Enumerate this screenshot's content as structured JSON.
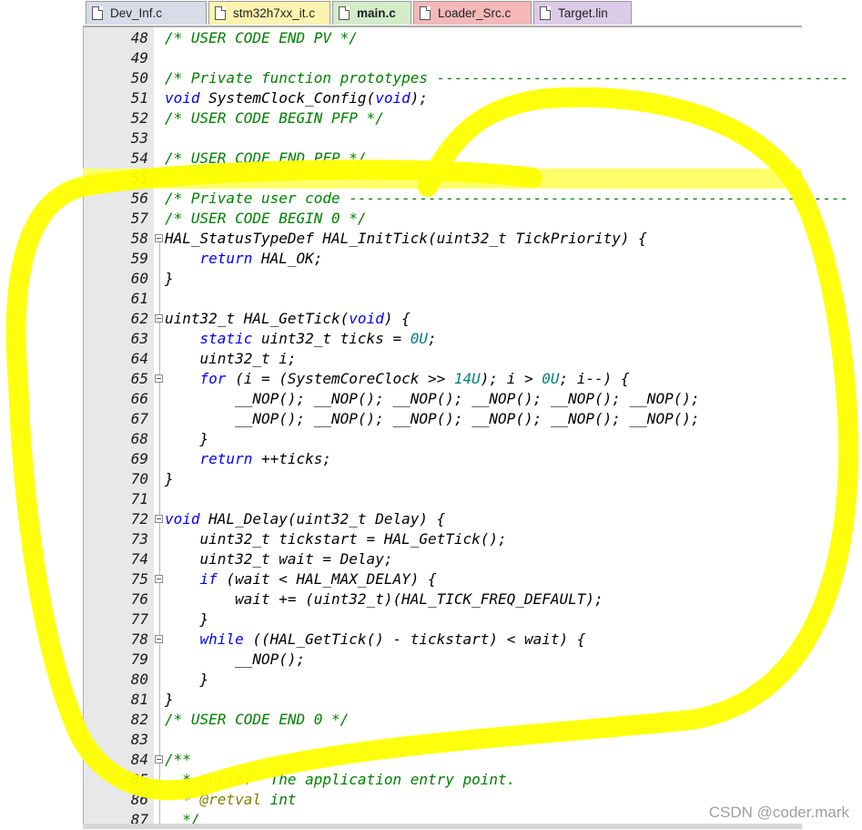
{
  "tabs": [
    {
      "label": "Dev_Inf.c",
      "color": "#d8dce8",
      "active": false
    },
    {
      "label": "stm32h7xx_it.c",
      "color": "#fcf3b0",
      "active": false
    },
    {
      "label": "main.c",
      "color": "#d2ecc8",
      "active": true
    },
    {
      "label": "Loader_Src.c",
      "color": "#f4b8b8",
      "active": false
    },
    {
      "label": "Target.lin",
      "color": "#dccbe8",
      "active": false
    }
  ],
  "current_line": 55,
  "lines": [
    {
      "n": "48",
      "code": "/* USER CODE END PV */",
      "type": "comment"
    },
    {
      "n": "49",
      "code": ""
    },
    {
      "n": "50",
      "code": "/* Private function prototypes -----------------------------------------------",
      "type": "comment"
    },
    {
      "n": "51",
      "code": "void SystemClock_Config(void);"
    },
    {
      "n": "52",
      "code": "/* USER CODE BEGIN PFP */",
      "type": "comment"
    },
    {
      "n": "53",
      "code": ""
    },
    {
      "n": "54",
      "code": "/* USER CODE END PFP */",
      "type": "comment"
    },
    {
      "n": "55",
      "code": ""
    },
    {
      "n": "56",
      "code": "/* Private user code ---------------------------------------------------------",
      "type": "comment"
    },
    {
      "n": "57",
      "code": "/* USER CODE BEGIN 0 */",
      "type": "comment"
    },
    {
      "n": "58",
      "code": "HAL_StatusTypeDef HAL_InitTick(uint32_t TickPriority) {",
      "fold": true
    },
    {
      "n": "59",
      "code": "    return HAL_OK;"
    },
    {
      "n": "60",
      "code": "}"
    },
    {
      "n": "61",
      "code": ""
    },
    {
      "n": "62",
      "code": "uint32_t HAL_GetTick(void) {",
      "fold": true
    },
    {
      "n": "63",
      "code": "    static uint32_t ticks = 0U;"
    },
    {
      "n": "64",
      "code": "    uint32_t i;"
    },
    {
      "n": "65",
      "code": "    for (i = (SystemCoreClock >> 14U); i > 0U; i--) {",
      "fold": true
    },
    {
      "n": "66",
      "code": "        __NOP(); __NOP(); __NOP(); __NOP(); __NOP(); __NOP();"
    },
    {
      "n": "67",
      "code": "        __NOP(); __NOP(); __NOP(); __NOP(); __NOP(); __NOP();"
    },
    {
      "n": "68",
      "code": "    }"
    },
    {
      "n": "69",
      "code": "    return ++ticks;"
    },
    {
      "n": "70",
      "code": "}"
    },
    {
      "n": "71",
      "code": ""
    },
    {
      "n": "72",
      "code": "void HAL_Delay(uint32_t Delay) {",
      "fold": true
    },
    {
      "n": "73",
      "code": "    uint32_t tickstart = HAL_GetTick();"
    },
    {
      "n": "74",
      "code": "    uint32_t wait = Delay;"
    },
    {
      "n": "75",
      "code": "    if (wait < HAL_MAX_DELAY) {",
      "fold": true
    },
    {
      "n": "76",
      "code": "        wait += (uint32_t)(HAL_TICK_FREQ_DEFAULT);"
    },
    {
      "n": "77",
      "code": "    }"
    },
    {
      "n": "78",
      "code": "    while ((HAL_GetTick() - tickstart) < wait) {",
      "fold": true
    },
    {
      "n": "79",
      "code": "        __NOP();"
    },
    {
      "n": "80",
      "code": "    }"
    },
    {
      "n": "81",
      "code": "}"
    },
    {
      "n": "82",
      "code": "/* USER CODE END 0 */",
      "type": "comment"
    },
    {
      "n": "83",
      "code": ""
    },
    {
      "n": "84",
      "code": "/**",
      "type": "comment",
      "fold": true
    },
    {
      "n": "85",
      "code": "  * @brief  The application entry point.",
      "type": "doc"
    },
    {
      "n": "86",
      "code": "  * @retval int",
      "type": "doc"
    },
    {
      "n": "87",
      "code": "  */",
      "type": "comment"
    }
  ],
  "keywords": [
    "void",
    "static",
    "for",
    "return",
    "if",
    "while"
  ],
  "colors": {
    "highlight": "#ffff00",
    "comment": "#008000",
    "keyword": "#0000ff",
    "number": "#008080",
    "doc_tag": "#808000",
    "current_line": "#ffff6a"
  },
  "watermark": "CSDN @coder.mark"
}
